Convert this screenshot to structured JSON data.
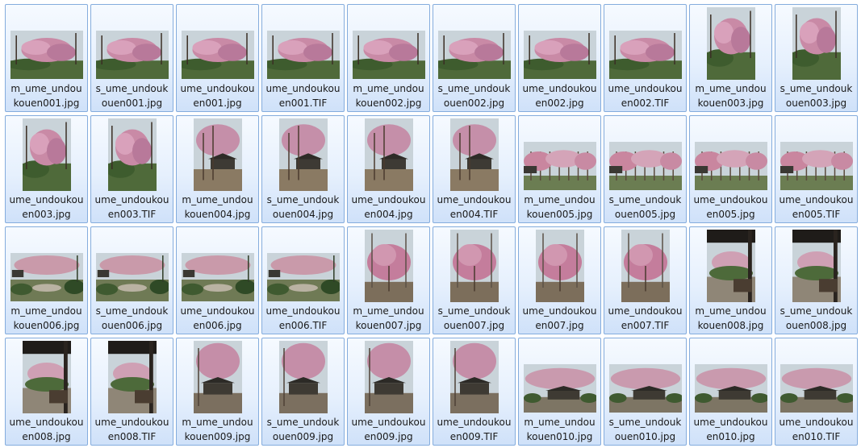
{
  "explorer": {
    "files": [
      {
        "label": "m_ume_undou\nkouen001.jpg",
        "orientation": "landscape",
        "scene": "blossom"
      },
      {
        "label": "s_ume_undouk\nouen001.jpg",
        "orientation": "landscape",
        "scene": "blossom"
      },
      {
        "label": "ume_undoukou\nen001.jpg",
        "orientation": "landscape",
        "scene": "blossom"
      },
      {
        "label": "ume_undoukou\nen001.TIF",
        "orientation": "landscape",
        "scene": "blossom"
      },
      {
        "label": "m_ume_undou\nkouen002.jpg",
        "orientation": "landscape",
        "scene": "blossom"
      },
      {
        "label": "s_ume_undouk\nouen002.jpg",
        "orientation": "landscape",
        "scene": "blossom"
      },
      {
        "label": "ume_undoukou\nen002.jpg",
        "orientation": "landscape",
        "scene": "blossom"
      },
      {
        "label": "ume_undoukou\nen002.TIF",
        "orientation": "landscape",
        "scene": "blossom"
      },
      {
        "label": "m_ume_undou\nkouen003.jpg",
        "orientation": "portrait",
        "scene": "blossom"
      },
      {
        "label": "s_ume_undouk\nouen003.jpg",
        "orientation": "portrait",
        "scene": "blossom"
      },
      {
        "label": "ume_undoukou\nen003.jpg",
        "orientation": "portrait",
        "scene": "blossom"
      },
      {
        "label": "ume_undoukou\nen003.TIF",
        "orientation": "portrait",
        "scene": "blossom"
      },
      {
        "label": "m_ume_undou\nkouen004.jpg",
        "orientation": "portrait",
        "scene": "hut"
      },
      {
        "label": "s_ume_undouk\nouen004.jpg",
        "orientation": "portrait",
        "scene": "hut"
      },
      {
        "label": "ume_undoukou\nen004.jpg",
        "orientation": "portrait",
        "scene": "hut"
      },
      {
        "label": "ume_undoukou\nen004.TIF",
        "orientation": "portrait",
        "scene": "hut"
      },
      {
        "label": "m_ume_undou\nkouen005.jpg",
        "orientation": "landscape",
        "scene": "grove"
      },
      {
        "label": "s_ume_undouk\nouen005.jpg",
        "orientation": "landscape",
        "scene": "grove"
      },
      {
        "label": "ume_undoukou\nen005.jpg",
        "orientation": "landscape",
        "scene": "grove"
      },
      {
        "label": "ume_undoukou\nen005.TIF",
        "orientation": "landscape",
        "scene": "grove"
      },
      {
        "label": "m_ume_undou\nkouen006.jpg",
        "orientation": "landscape",
        "scene": "garden"
      },
      {
        "label": "s_ume_undouk\nouen006.jpg",
        "orientation": "landscape",
        "scene": "garden"
      },
      {
        "label": "ume_undoukou\nen006.jpg",
        "orientation": "landscape",
        "scene": "garden"
      },
      {
        "label": "ume_undoukou\nen006.TIF",
        "orientation": "landscape",
        "scene": "garden"
      },
      {
        "label": "m_ume_undou\nkouen007.jpg",
        "orientation": "portrait",
        "scene": "tree"
      },
      {
        "label": "s_ume_undouk\nouen007.jpg",
        "orientation": "portrait",
        "scene": "tree"
      },
      {
        "label": "ume_undoukou\nen007.jpg",
        "orientation": "portrait",
        "scene": "tree"
      },
      {
        "label": "ume_undoukou\nen007.TIF",
        "orientation": "portrait",
        "scene": "tree"
      },
      {
        "label": "m_ume_undou\nkouen008.jpg",
        "orientation": "portrait",
        "scene": "gazebo"
      },
      {
        "label": "s_ume_undouk\nouen008.jpg",
        "orientation": "portrait",
        "scene": "gazebo"
      },
      {
        "label": "ume_undoukou\nen008.jpg",
        "orientation": "portrait",
        "scene": "gazebo"
      },
      {
        "label": "ume_undoukou\nen008.TIF",
        "orientation": "portrait",
        "scene": "gazebo"
      },
      {
        "label": "m_ume_undou\nkouen009.jpg",
        "orientation": "portrait",
        "scene": "shelter"
      },
      {
        "label": "s_ume_undouk\nouen009.jpg",
        "orientation": "portrait",
        "scene": "shelter"
      },
      {
        "label": "ume_undoukou\nen009.jpg",
        "orientation": "portrait",
        "scene": "shelter"
      },
      {
        "label": "ume_undoukou\nen009.TIF",
        "orientation": "portrait",
        "scene": "shelter"
      },
      {
        "label": "m_ume_undou\nkouen010.jpg",
        "orientation": "landscape",
        "scene": "shelter-wide"
      },
      {
        "label": "s_ume_undouk\nouen010.jpg",
        "orientation": "landscape",
        "scene": "shelter-wide"
      },
      {
        "label": "ume_undoukou\nen010.jpg",
        "orientation": "landscape",
        "scene": "shelter-wide"
      },
      {
        "label": "ume_undoukou\nen010.TIF",
        "orientation": "landscape",
        "scene": "shelter-wide"
      }
    ]
  }
}
